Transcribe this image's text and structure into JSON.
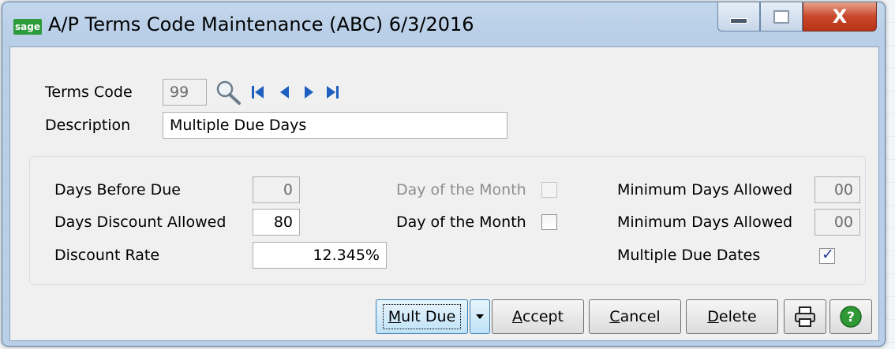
{
  "window": {
    "app_logo": "sage",
    "title": "A/P Terms Code Maintenance (ABC) 6/3/2016",
    "close_glyph": "X"
  },
  "header": {
    "terms_code_label": "Terms Code",
    "terms_code_value": "99",
    "description_label": "Description",
    "description_value": "Multiple Due Days"
  },
  "terms": {
    "days_before_due_label": "Days Before Due",
    "days_before_due_value": "0",
    "days_discount_label": "Days Discount Allowed",
    "days_discount_value": "80",
    "discount_rate_label": "Discount Rate",
    "discount_rate_value": "12.345%",
    "day_of_month_1_label": "Day of the Month",
    "day_of_month_2_label": "Day of the Month",
    "min_days_1_label": "Minimum Days Allowed",
    "min_days_1_value": "00",
    "min_days_2_label": "Minimum Days Allowed",
    "min_days_2_value": "00",
    "multiple_due_dates_label": "Multiple Due Dates",
    "multiple_due_dates_checked": true
  },
  "buttons": {
    "mult_due_first": "M",
    "mult_due_rest": "ult Due",
    "accept_first": "A",
    "accept_rest": "ccept",
    "cancel_first": "C",
    "cancel_rest": "ancel",
    "delete_first": "D",
    "delete_rest": "elete"
  },
  "icons": {
    "lookup": "magnifier-icon",
    "nav_first": "first-record-icon",
    "nav_prev": "previous-record-icon",
    "nav_next": "next-record-icon",
    "nav_last": "last-record-icon",
    "print": "printer-icon",
    "help": "help-icon"
  },
  "colors": {
    "nav_blue": "#1f5fbf",
    "help_green": "#2f9a35",
    "check_blue": "#2c3e9b"
  }
}
